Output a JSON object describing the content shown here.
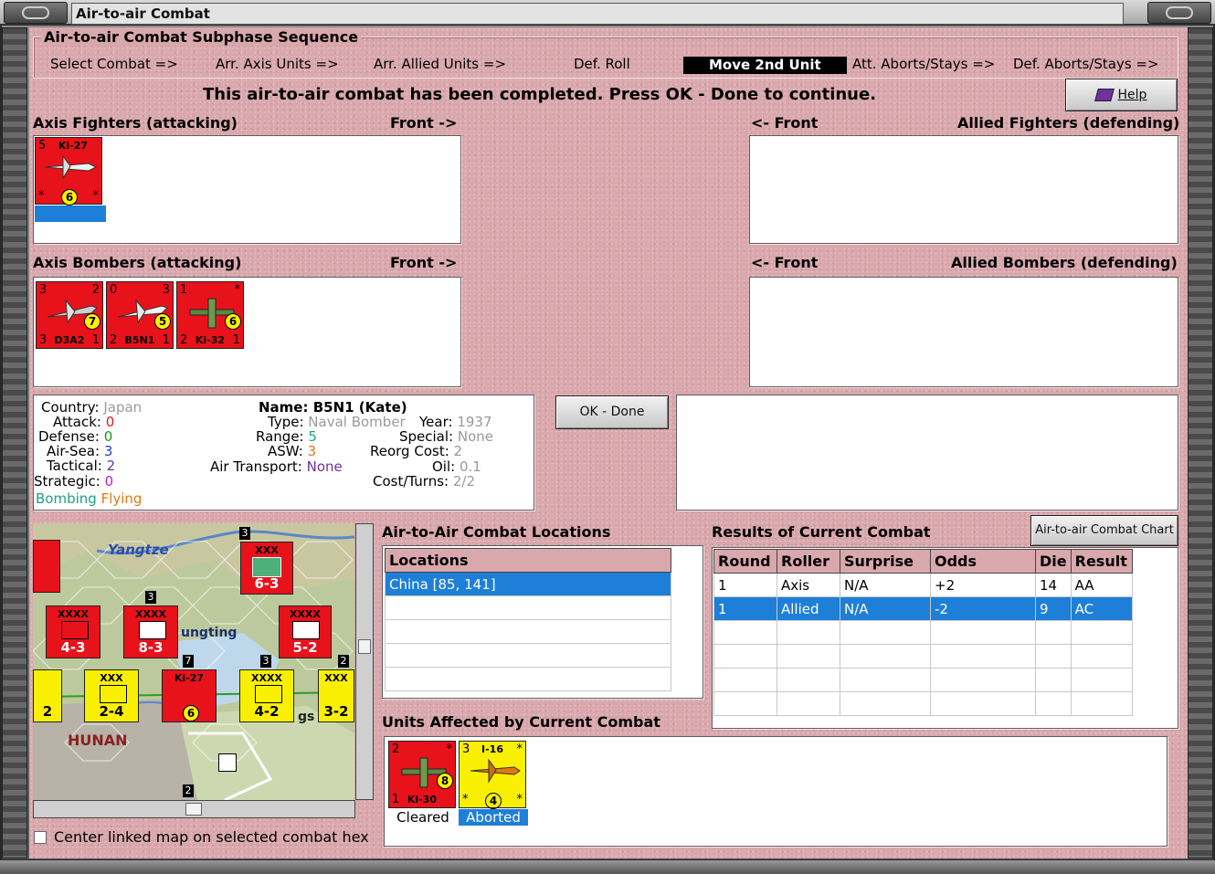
{
  "window": {
    "title": "Air-to-air Combat"
  },
  "sequence": {
    "title": "Air-to-air Combat Subphase Sequence",
    "steps": [
      "Select Combat =>",
      "Arr. Axis Units =>",
      "Arr. Allied Units =>",
      "Def. Roll",
      "Move 2nd Unit",
      "Att. Aborts/Stays =>",
      "Def. Aborts/Stays =>"
    ],
    "active_index": 4
  },
  "banner": "This air-to-air combat has been completed.  Press OK - Done to continue.",
  "buttons": {
    "help": "Help",
    "ok_done": "OK - Done",
    "chart": "Air-to-air Combat Chart"
  },
  "axis_fighters": {
    "label": "Axis Fighters (attacking)",
    "front": "Front ->",
    "units": [
      {
        "name": "Ki-27",
        "tl": "5",
        "badge": "6",
        "bl": "*",
        "br": "*"
      }
    ]
  },
  "allied_fighters": {
    "label": "Allied Fighters (defending)",
    "front": "<- Front"
  },
  "axis_bombers": {
    "label": "Axis Bombers (attacking)",
    "front": "Front ->",
    "units": [
      {
        "name": "D3A2",
        "tl": "3",
        "tr": "2",
        "bl": "3",
        "br": "1",
        "badge": "7"
      },
      {
        "name": "B5N1",
        "tl": "0",
        "tr": "3",
        "bl": "2",
        "br": "1",
        "badge": "5"
      },
      {
        "name": "Ki-32",
        "tl": "1",
        "tr": "*",
        "bl": "2",
        "br": "1",
        "badge": "6"
      }
    ]
  },
  "allied_bombers": {
    "label": "Allied Bombers (defending)",
    "front": "<- Front"
  },
  "unit_info": {
    "country_k": "Country:",
    "country": "Japan",
    "attack_k": "Attack:",
    "attack": "0",
    "defense_k": "Defense:",
    "defense": "0",
    "airsea_k": "Air-Sea:",
    "airsea": "3",
    "tactical_k": "Tactical:",
    "tactical": "2",
    "strategic_k": "Strategic:",
    "strategic": "0",
    "bombing": "Bombing",
    "flying": "Flying",
    "name_k": "Name:",
    "name": "B5N1 (Kate)",
    "type_k": "Type:",
    "type": "Naval Bomber",
    "range_k": "Range:",
    "range": "5",
    "asw_k": "ASW:",
    "asw": "3",
    "transport_k": "Air Transport:",
    "transport": "None",
    "year_k": "Year:",
    "year": "1937",
    "special_k": "Special:",
    "special": "None",
    "reorg_k": "Reorg Cost:",
    "reorg": "2",
    "oil_k": "Oil:",
    "oil": "0.1",
    "cost_k": "Cost/Turns:",
    "cost": "2/2"
  },
  "map": {
    "labels": {
      "yangtze": "Yangtze",
      "tungting": "ungting",
      "hunan": "HUNAN",
      "gs": "gs"
    },
    "units": [
      {
        "val": "6-3",
        "kind": "XXX",
        "side": "red"
      },
      {
        "val": "4-3",
        "kind": "XXXX",
        "side": "red"
      },
      {
        "val": "8-3",
        "kind": "XXXX",
        "side": "red"
      },
      {
        "val": "5-2",
        "kind": "XXXX",
        "side": "red"
      },
      {
        "val": "2-4",
        "kind": "XXX",
        "side": "yellow"
      },
      {
        "val": "4-2",
        "kind": "XXXX",
        "side": "yellow"
      },
      {
        "val": "3-2",
        "kind": "XXX",
        "side": "yellow"
      },
      {
        "val": "2",
        "kind": "XX",
        "side": "yellow"
      },
      {
        "val": "6",
        "kind": "Ki-27",
        "side": "red"
      }
    ],
    "stack_numbers": [
      "3",
      "3",
      "7",
      "3",
      "2",
      "2"
    ],
    "center_check": "Center linked map on selected combat hex"
  },
  "locations": {
    "label": "Air-to-Air Combat Locations",
    "header": "Locations",
    "rows": [
      "China [85, 141]"
    ]
  },
  "results": {
    "label": "Results of Current Combat",
    "headers": [
      "Round",
      "Roller",
      "Surprise",
      "Odds",
      "Die",
      "Result"
    ],
    "rows": [
      [
        "1",
        "Axis",
        "N/A",
        "+2",
        "14",
        "AA"
      ],
      [
        "1",
        "Allied",
        "N/A",
        "-2",
        "9",
        "AC"
      ]
    ],
    "selected_row": 1
  },
  "affected": {
    "label": "Units Affected by Current Combat",
    "units": [
      {
        "name": "Ki-30",
        "tl": "2",
        "tr": "*",
        "bl": "1",
        "badge": "8",
        "status": "Cleared"
      },
      {
        "name": "I-16",
        "tl": "3",
        "tr": "*",
        "bl": "*",
        "br": "*",
        "badge": "4",
        "status": "Aborted"
      }
    ]
  },
  "colors": {
    "background": "#d9a8ad",
    "axis_red": "#e8121b",
    "allied_yellow": "#f8f000",
    "selection_blue": "#1e7fd8"
  }
}
